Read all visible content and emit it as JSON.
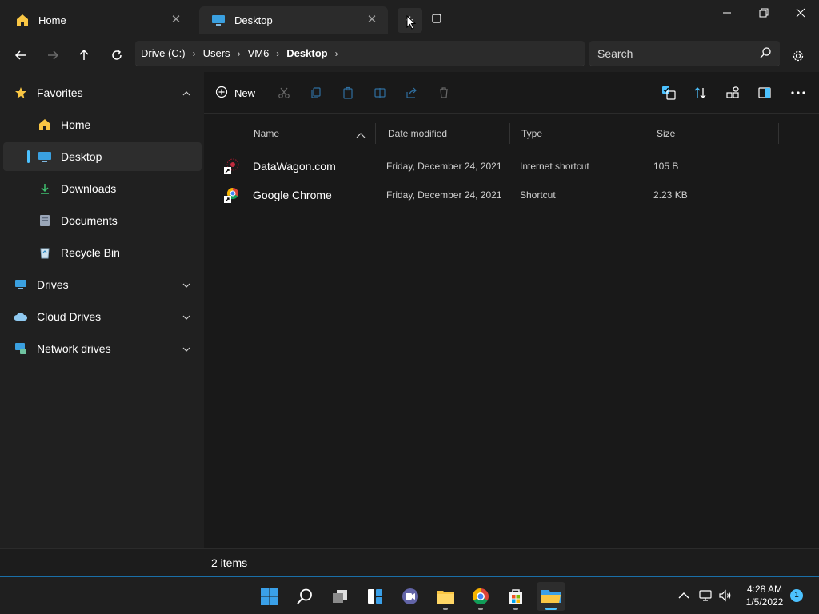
{
  "tabs": [
    {
      "label": "Home",
      "icon": "home-icon"
    },
    {
      "label": "Desktop",
      "icon": "desktop-icon"
    }
  ],
  "new_tab_label": "+",
  "breadcrumbs": [
    "Drive (C:)",
    "Users",
    "VM6",
    "Desktop"
  ],
  "search": {
    "placeholder": "Search"
  },
  "sidebar": {
    "favorites": {
      "label": "Favorites"
    },
    "items": [
      {
        "label": "Home"
      },
      {
        "label": "Desktop"
      },
      {
        "label": "Downloads"
      },
      {
        "label": "Documents"
      },
      {
        "label": "Recycle Bin"
      }
    ],
    "groups": [
      {
        "label": "Drives"
      },
      {
        "label": "Cloud Drives"
      },
      {
        "label": "Network drives"
      }
    ]
  },
  "toolbar": {
    "new_label": "New"
  },
  "columns": {
    "name": "Name",
    "date": "Date modified",
    "type": "Type",
    "size": "Size"
  },
  "files": [
    {
      "name": "DataWagon.com",
      "date": "Friday, December 24, 2021",
      "type": "Internet shortcut",
      "size": "105 B"
    },
    {
      "name": "Google Chrome",
      "date": "Friday, December 24, 2021",
      "type": "Shortcut",
      "size": "2.23 KB"
    }
  ],
  "status": {
    "items": "2 items"
  },
  "clock": {
    "time": "4:28 AM",
    "date": "1/5/2022"
  },
  "notifications": {
    "count": "1"
  },
  "colors": {
    "accent": "#4cc2ff",
    "folder": "#f9c644",
    "background": "#191919"
  }
}
